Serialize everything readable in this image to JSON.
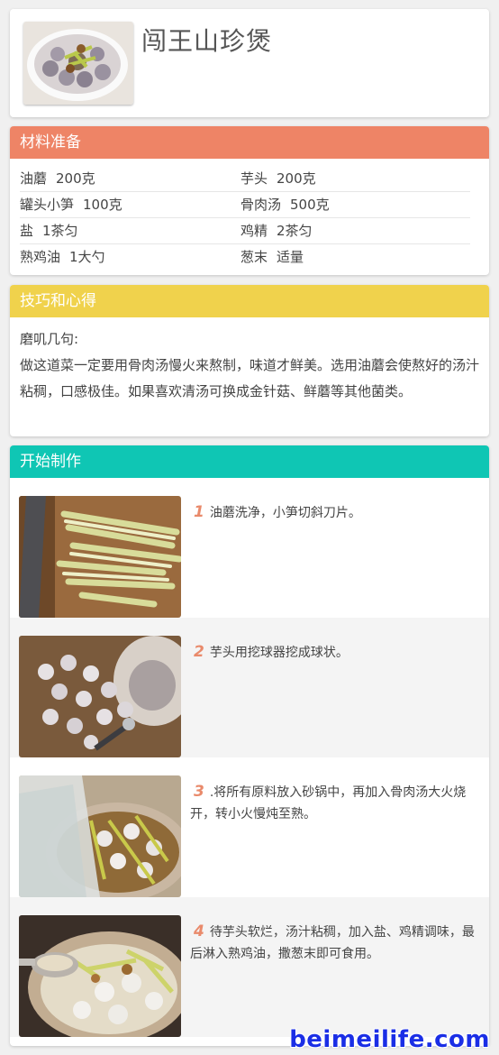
{
  "recipe": {
    "title": "闯王山珍煲"
  },
  "ingredients": {
    "header": "材料准备",
    "header_color": "#ee8466",
    "rows": [
      [
        {
          "name": "油蘑",
          "amount": "200克"
        },
        {
          "name": "芋头",
          "amount": "200克"
        }
      ],
      [
        {
          "name": "罐头小笋",
          "amount": "100克"
        },
        {
          "name": "骨肉汤",
          "amount": "500克"
        }
      ],
      [
        {
          "name": "盐",
          "amount": "1茶匀"
        },
        {
          "name": "鸡精",
          "amount": "2茶匀"
        }
      ],
      [
        {
          "name": "熟鸡油",
          "amount": "1大勺"
        },
        {
          "name": "葱末",
          "amount": "适量"
        }
      ]
    ]
  },
  "tips": {
    "header": "技巧和心得",
    "header_color": "#f0d24c",
    "subtitle": "磨叽几句:",
    "body": "做这道菜一定要用骨肉汤慢火来熬制，味道才鲜美。选用油蘑会使熬好的汤汁粘稠，口感极佳。如果喜欢清汤可换成金针菇、鲜蘑等其他菌类。"
  },
  "steps": {
    "header": "开始制作",
    "header_color": "#0fc6b4",
    "items": [
      {
        "num": "1",
        "text": "油蘑洗净，小笋切斜刀片。"
      },
      {
        "num": "2",
        "text": "芋头用挖球器挖成球状。"
      },
      {
        "num": "3",
        "text": ".将所有原料放入砂锅中，再加入骨肉汤大火烧开，转小火慢炖至熟。"
      },
      {
        "num": "4",
        "text": "待芋头软烂，汤汁粘稠，加入盐、鸡精调味，最后淋入熟鸡油，撒葱末即可食用。"
      }
    ]
  },
  "watermark": "beimeilife.com"
}
